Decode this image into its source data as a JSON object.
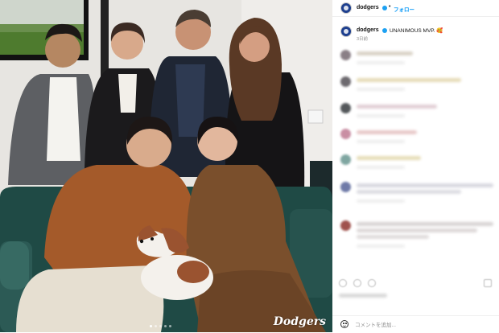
{
  "post": {
    "image_alt": "Group photo: four people standing behind a couple seated on a green sofa with a brown-and-white dog",
    "watermark": "Dodgers",
    "carousel_pages": 5,
    "carousel_active": 0
  },
  "sidebar": {
    "header": {
      "username": "dodgers",
      "separator": "•",
      "follow_label": "フォロー"
    },
    "caption": {
      "username": "dodgers",
      "text": "UNANIMOUS MVP. 🥰",
      "time": "3日前"
    },
    "comment_input": {
      "placeholder": "コメントを追加..."
    }
  },
  "colors": {
    "accent": "#0095f6",
    "verified": "#1da1f2",
    "sofa": "#1f4a45"
  },
  "icons": {
    "emoji": "smile-icon",
    "verified": "verified-badge-icon"
  }
}
